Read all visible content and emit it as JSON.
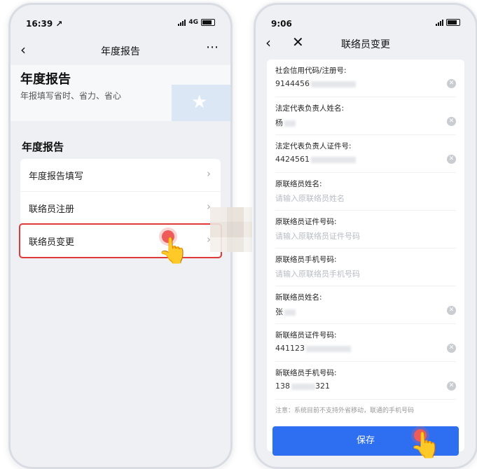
{
  "left_phone": {
    "status": {
      "time": "16:39 ↗",
      "network": "4G"
    },
    "nav": {
      "title": "年度报告",
      "more": "⋯"
    },
    "hero": {
      "title": "年度报告",
      "subtitle": "年报填写省时、省力、省心"
    },
    "section_title": "年度报告",
    "menu_items": [
      {
        "label": "年度报告填写"
      },
      {
        "label": "联络员注册"
      },
      {
        "label": "联络员变更"
      }
    ]
  },
  "right_phone": {
    "status": {
      "time": "9:06"
    },
    "nav": {
      "title": "联络员变更"
    },
    "fields": [
      {
        "label": "社会信用代码/注册号:",
        "value": "9144456",
        "placeholder": ""
      },
      {
        "label": "法定代表负责人姓名:",
        "value": "杨",
        "placeholder": ""
      },
      {
        "label": "法定代表负责人证件号:",
        "value": "4424561",
        "placeholder": ""
      },
      {
        "label": "原联络员姓名:",
        "value": "",
        "placeholder": "请输入原联络员姓名"
      },
      {
        "label": "原联络员证件号码:",
        "value": "",
        "placeholder": "请输入原联络员证件号码"
      },
      {
        "label": "原联络员手机号码:",
        "value": "",
        "placeholder": "请输入原联络员手机号码"
      },
      {
        "label": "新联络员姓名:",
        "value": "张",
        "placeholder": ""
      },
      {
        "label": "新联络员证件号码:",
        "value": "441123",
        "placeholder": ""
      },
      {
        "label": "新联络员手机号码:",
        "value": "138",
        "value_end": "321",
        "placeholder": ""
      }
    ],
    "note": "注意：系统目前不支持外省移动，联通的手机号码",
    "save_label": "保存"
  },
  "colors": {
    "accent": "#2e6ff2",
    "highlight": "#e03a3a",
    "tap": "#ef5a5a"
  }
}
